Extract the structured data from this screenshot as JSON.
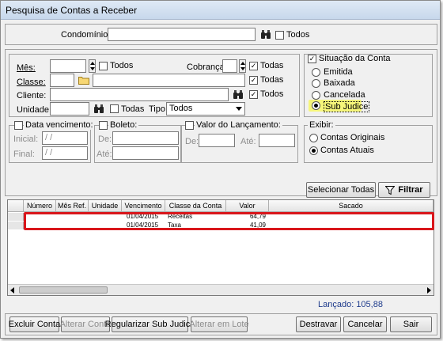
{
  "window": {
    "title": "Pesquisa de Contas a Receber"
  },
  "condominio": {
    "label": "Condomínio:",
    "value": "",
    "todos_label": "Todos"
  },
  "filters": {
    "mes_label": "Mês:",
    "mes_todos": "Todos",
    "cobranca_label": "Cobrança:",
    "cobranca_todas": "Todas",
    "classe_label": "Classe:",
    "classe_todas": "Todas",
    "cliente_label": "Cliente:",
    "cliente_todos": "Todos",
    "unidade_label": "Unidade:",
    "unidade_todas": "Todas",
    "tipo_label": "Tipo:",
    "tipo_value": "Todos"
  },
  "situacao": {
    "title": "Situação da Conta",
    "options": [
      "Emitida",
      "Baixada",
      "Cancelada",
      "Sub Judice"
    ],
    "selected": "Sub Judice"
  },
  "data_vencimento": {
    "title": "Data vencimento:",
    "inicial_label": "Inicial:",
    "final_label": "Final:",
    "inicial_value": "/ /",
    "final_value": "/ /"
  },
  "boleto": {
    "title": "Boleto:",
    "de_label": "De:",
    "ate_label": "Até:"
  },
  "valor_lancamento": {
    "title": "Valor do Lançamento:",
    "de_label": "De:",
    "ate_label": "Até:"
  },
  "exibir": {
    "title": "Exibir:",
    "options": [
      "Contas Originais",
      "Contas Atuais"
    ],
    "selected": "Contas Atuais"
  },
  "actions": {
    "selecionar_todas": "Selecionar Todas",
    "filtrar": "Filtrar"
  },
  "table": {
    "columns": [
      "Número",
      "Mês Ref.",
      "Unidade",
      "Vencimento",
      "Classe da Conta",
      "Valor",
      "Sacado"
    ],
    "rows": [
      {
        "numero": "",
        "mes_ref": "",
        "unidade": "",
        "vencimento": "01/04/2015",
        "classe": "Receitas",
        "valor": "64,79",
        "sacado": ""
      },
      {
        "numero": "",
        "mes_ref": "",
        "unidade": "",
        "vencimento": "01/04/2015",
        "classe": "Taxa",
        "valor": "41,09",
        "sacado": ""
      }
    ]
  },
  "lancado": "Lançado: 105,88",
  "footer": {
    "excluir": "Excluir Conta",
    "alterar": "Alterar Conta",
    "regularizar": "Regularizar Sub Judice",
    "alterar_lote": "Alterar em Lote",
    "destravar": "Destravar",
    "cancelar": "Cancelar",
    "sair": "Sair"
  },
  "colors": {
    "highlight": "#f6f67a",
    "selection_box": "#d9161b",
    "lancado_text": "#1f3c8c"
  }
}
